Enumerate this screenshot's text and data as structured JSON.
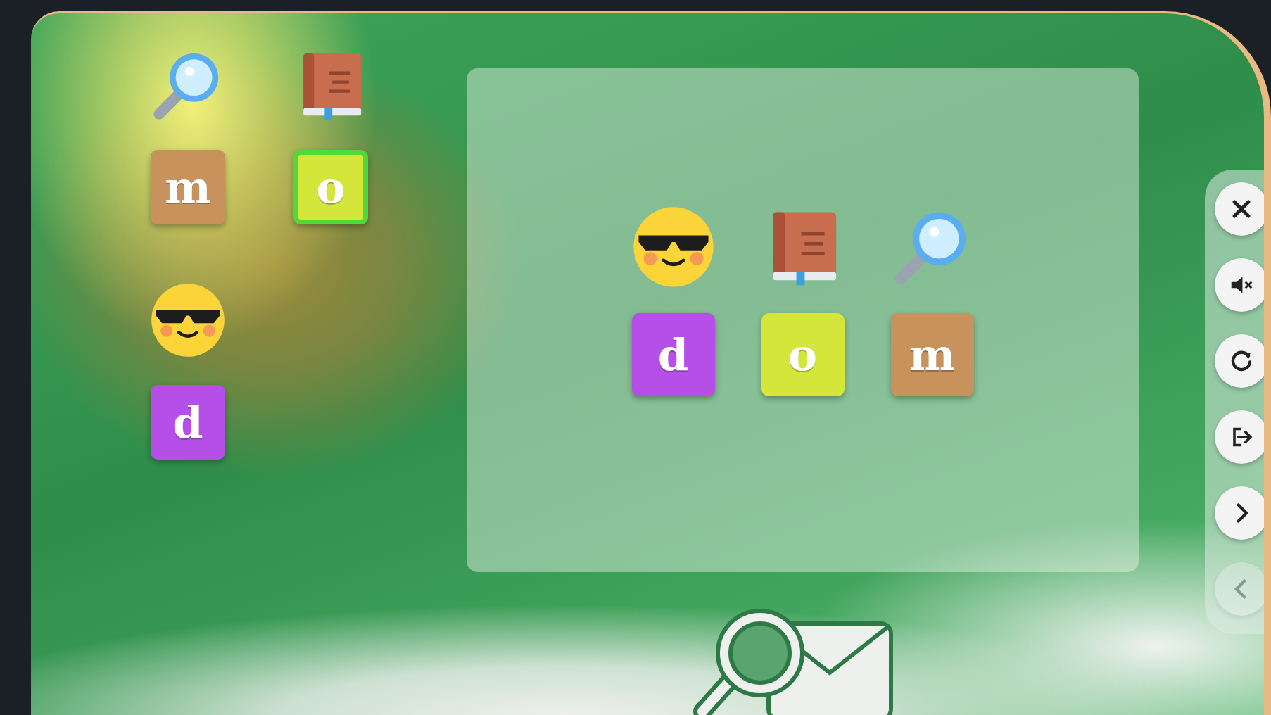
{
  "left_board": {
    "columns": [
      [
        {
          "kind": "magnifier",
          "selected": false
        },
        {
          "kind": "letter",
          "letter": "m",
          "color": "#c8925c",
          "selected": false
        },
        {
          "kind": "face",
          "selected": false
        },
        {
          "kind": "letter",
          "letter": "d",
          "color": "#b64fe8",
          "selected": false
        }
      ],
      [
        {
          "kind": "book",
          "selected": false
        },
        {
          "kind": "letter",
          "letter": "o",
          "color": "#d5e63a",
          "selected": true
        }
      ]
    ]
  },
  "answer_panel": {
    "rows": [
      [
        {
          "kind": "face",
          "selected": false
        },
        {
          "kind": "book",
          "selected": false
        },
        {
          "kind": "magnifier",
          "selected": false
        }
      ],
      [
        {
          "kind": "letter",
          "letter": "d",
          "color": "#b64fe8",
          "selected": false
        },
        {
          "kind": "letter",
          "letter": "o",
          "color": "#d5e63a",
          "selected": false
        },
        {
          "kind": "letter",
          "letter": "m",
          "color": "#c8925c",
          "selected": false
        }
      ]
    ]
  },
  "side_menu": [
    {
      "kind": "close",
      "disabled": false
    },
    {
      "kind": "mute",
      "disabled": false
    },
    {
      "kind": "restart",
      "disabled": false
    },
    {
      "kind": "exit",
      "disabled": false
    },
    {
      "kind": "next",
      "disabled": false
    },
    {
      "kind": "back",
      "disabled": true
    }
  ]
}
